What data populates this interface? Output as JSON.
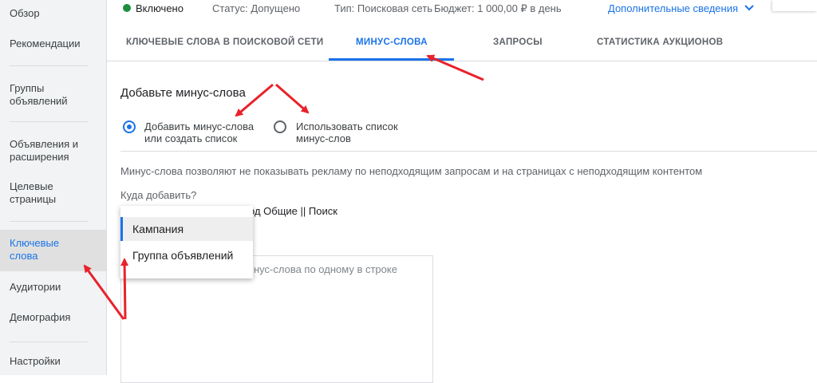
{
  "sidebar": {
    "items": [
      {
        "label": "Обзор"
      },
      {
        "label": "Рекомендации"
      },
      {
        "label": "Группы объявлений"
      },
      {
        "label": "Объявления и расширения"
      },
      {
        "label": "Целевые страницы"
      },
      {
        "label": "Ключевые слова"
      },
      {
        "label": "Аудитории"
      },
      {
        "label": "Демография"
      },
      {
        "label": "Настройки"
      }
    ]
  },
  "topbar": {
    "status_enabled": "Включено",
    "status": "Статус: Допущено",
    "type": "Тип: Поисковая сеть",
    "budget": "Бюджет: 1 000,00 ₽ в день",
    "more": "Дополнительные сведения"
  },
  "tabs": [
    {
      "label": "КЛЮЧЕВЫЕ СЛОВА В ПОИСКОВОЙ СЕТИ"
    },
    {
      "label": "МИНУС-СЛОВА"
    },
    {
      "label": "ЗАПРОСЫ"
    },
    {
      "label": "СТАТИСТИКА АУКЦИОНОВ"
    }
  ],
  "content": {
    "heading": "Добавьте минус-слова",
    "option1_line1": "Добавить минус-слова",
    "option1_line2": "или создать список",
    "option2_line1": "Использовать список",
    "option2_line2": "минус-слов",
    "description": "Минус-слова позволяют не показывать рекламу по неподходящим запросам и на страницах с неподходящим контентом",
    "where_label": "Куда добавить?",
    "target_partial": "од Общие || Поиск",
    "textarea_placeholder": "нус-слова по одному в строке"
  },
  "dropdown": {
    "options": [
      "Кампания",
      "Группа объявлений"
    ],
    "selected": "Кампания"
  },
  "colors": {
    "accent": "#1a73e8",
    "annotation": "#e8222b",
    "enabled": "#1e8e3e"
  }
}
